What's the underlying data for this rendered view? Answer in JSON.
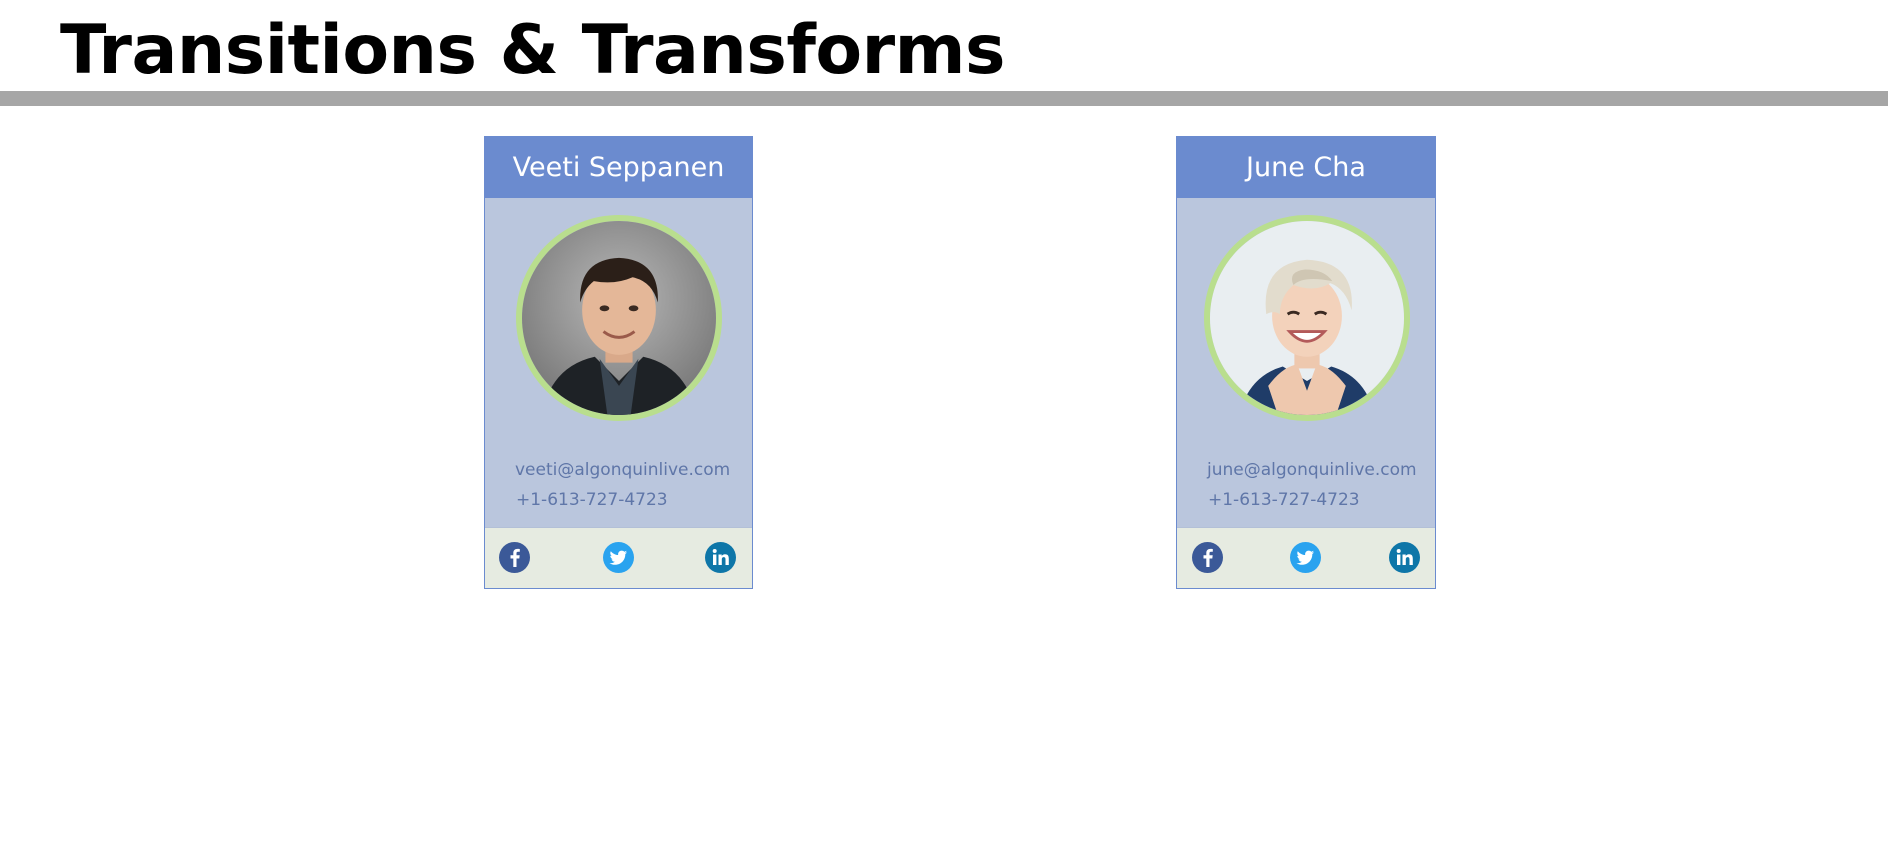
{
  "page": {
    "title": "Transitions & Transforms"
  },
  "cards": [
    {
      "name": "Veeti Seppanen",
      "email": "veeti@algonquinlive.com",
      "phone": "+1-613-727-4723",
      "social": [
        "facebook-icon",
        "twitter-icon",
        "linkedin-icon"
      ]
    },
    {
      "name": "June Cha",
      "email": "june@algonquinlive.com",
      "phone": "+1-613-727-4723",
      "social": [
        "facebook-icon",
        "twitter-icon",
        "linkedin-icon"
      ]
    }
  ],
  "colors": {
    "card_header": "#6b8bcf",
    "card_body": "#bac6dd",
    "card_footer": "#e6ebe1",
    "avatar_ring": "#b9de8e",
    "contact_text": "#5f76a8",
    "header_rule": "#a6a6a6",
    "facebook": "#3b5998",
    "twitter": "#2aa3ef",
    "linkedin": "#0e76a8"
  }
}
